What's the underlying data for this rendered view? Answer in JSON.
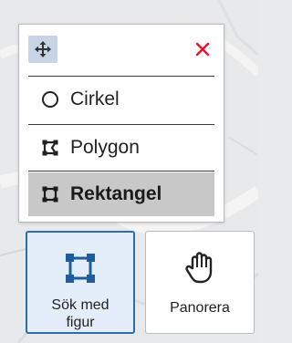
{
  "shape_panel": {
    "move_icon": "move-arrows-icon",
    "close_icon": "close-x-icon",
    "items": [
      {
        "label": "Cirkel",
        "icon": "circle-icon",
        "selected": false
      },
      {
        "label": "Polygon",
        "icon": "polygon-icon",
        "selected": false
      },
      {
        "label": "Rektangel",
        "icon": "rectangle-icon",
        "selected": true
      }
    ]
  },
  "toolbar": {
    "search_by_shape": {
      "line1": "Sök med",
      "line2": "figur",
      "icon": "shape-square-icon",
      "active": true
    },
    "pan": {
      "label": "Panorera",
      "icon": "hand-icon",
      "active": false
    }
  },
  "colors": {
    "accent": "#2e6cb0",
    "close": "#e8192c",
    "selected_item": "#c8c8c8",
    "active_button_bg": "#e4eefa",
    "move_handle_bg": "#c8d4e6"
  }
}
